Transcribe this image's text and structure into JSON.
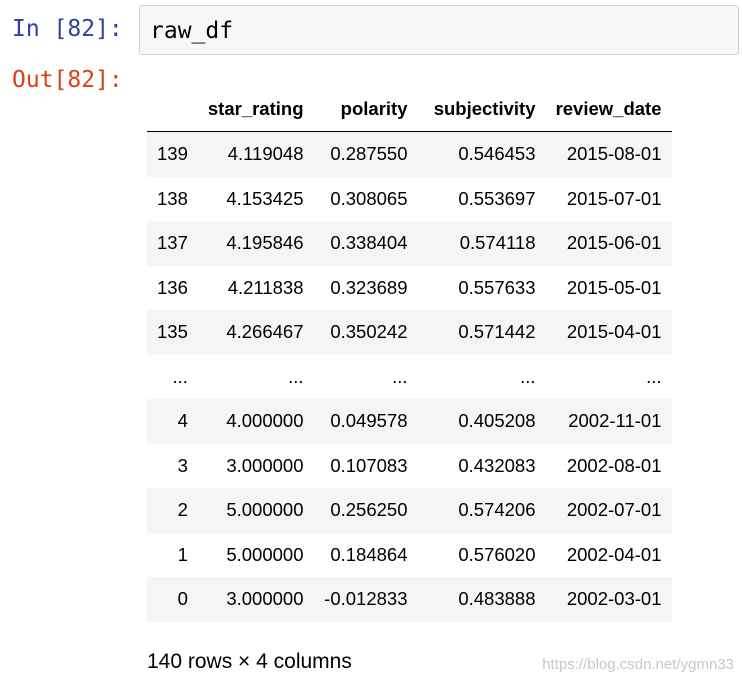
{
  "input_cell": {
    "prompt": "In [82]:",
    "code": "raw_df"
  },
  "output_cell": {
    "prompt": "Out[82]:"
  },
  "dataframe": {
    "columns": [
      "",
      "star_rating",
      "polarity",
      "subjectivity",
      "review_date"
    ],
    "rows": [
      [
        "139",
        "4.119048",
        "0.287550",
        "0.546453",
        "2015-08-01"
      ],
      [
        "138",
        "4.153425",
        "0.308065",
        "0.553697",
        "2015-07-01"
      ],
      [
        "137",
        "4.195846",
        "0.338404",
        "0.574118",
        "2015-06-01"
      ],
      [
        "136",
        "4.211838",
        "0.323689",
        "0.557633",
        "2015-05-01"
      ],
      [
        "135",
        "4.266467",
        "0.350242",
        "0.571442",
        "2015-04-01"
      ],
      [
        "...",
        "...",
        "...",
        "...",
        "..."
      ],
      [
        "4",
        "4.000000",
        "0.049578",
        "0.405208",
        "2002-11-01"
      ],
      [
        "3",
        "3.000000",
        "0.107083",
        "0.432083",
        "2002-08-01"
      ],
      [
        "2",
        "5.000000",
        "0.256250",
        "0.574206",
        "2002-07-01"
      ],
      [
        "1",
        "5.000000",
        "0.184864",
        "0.576020",
        "2002-04-01"
      ],
      [
        "0",
        "3.000000",
        "-0.012833",
        "0.483888",
        "2002-03-01"
      ]
    ],
    "shape_text": "140 rows × 4 columns"
  },
  "watermark": "https://blog.csdn.net/ygmn33",
  "colors": {
    "in_prompt": "#303f9f",
    "out_prompt": "#d84315",
    "input_bg": "#f7f7f7",
    "striped_row": "#f5f5f5"
  }
}
